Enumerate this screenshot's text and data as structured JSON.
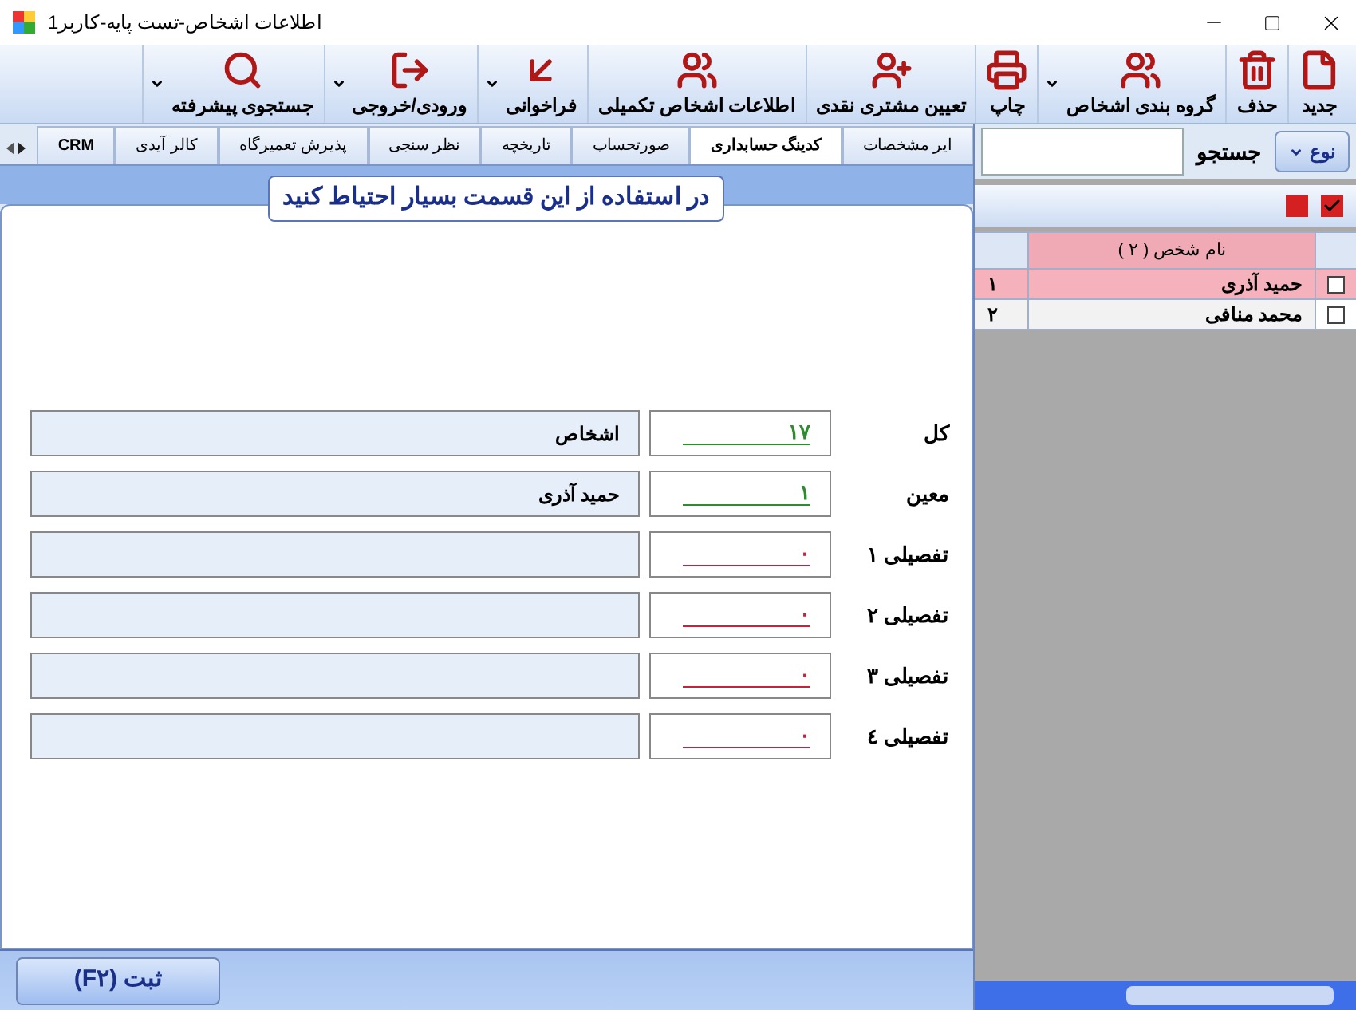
{
  "window": {
    "title": "اطلاعات اشخاص-تست پایه-کاربر1"
  },
  "toolbar": [
    {
      "kind": "new",
      "label": "جدید",
      "dropdown": false
    },
    {
      "kind": "delete",
      "label": "حذف",
      "dropdown": false
    },
    {
      "kind": "group",
      "label": "گروه بندی اشخاص",
      "dropdown": true
    },
    {
      "kind": "print",
      "label": "چاپ",
      "dropdown": false
    },
    {
      "kind": "adduser",
      "label": "تعیین مشتری نقدی",
      "dropdown": false
    },
    {
      "kind": "info",
      "label": "اطلاعات اشخاص تکمیلی",
      "dropdown": false
    },
    {
      "kind": "recall",
      "label": "فراخوانی",
      "dropdown": true
    },
    {
      "kind": "io",
      "label": "ورودی/خروجی",
      "dropdown": true
    },
    {
      "kind": "search",
      "label": "جستجوی پیشرفته",
      "dropdown": true
    }
  ],
  "tabs": [
    {
      "label": "ایر مشخصات",
      "selected": false
    },
    {
      "label": "کدینگ حسابداری",
      "selected": true
    },
    {
      "label": "صورتحساب",
      "selected": false
    },
    {
      "label": "تاریخچه",
      "selected": false
    },
    {
      "label": "نظر سنجی",
      "selected": false
    },
    {
      "label": "پذیرش تعمیرگاه",
      "selected": false
    },
    {
      "label": "کالر آیدی",
      "selected": false
    },
    {
      "label": "CRM",
      "selected": false
    }
  ],
  "warning": "در استفاده از این قسمت بسیار احتیاط کنید",
  "rows": [
    {
      "label": "کل",
      "code": "۱۷",
      "color": "#2e8b2e",
      "name": "اشخاص"
    },
    {
      "label": "معین",
      "code": "۱",
      "color": "#2e8b2e",
      "name": "حمید آذری"
    },
    {
      "label": "تفصیلی ۱",
      "code": "۰",
      "color": "#cc1f3c",
      "name": ""
    },
    {
      "label": "تفصیلی ۲",
      "code": "۰",
      "color": "#cc1f3c",
      "name": ""
    },
    {
      "label": "تفصیلی ۳",
      "code": "۰",
      "color": "#cc1f3c",
      "name": ""
    },
    {
      "label": "تفصیلی ٤",
      "code": "۰",
      "color": "#cc1f3c",
      "name": ""
    }
  ],
  "save_button": "ثبت (F۲)",
  "search": {
    "type_button": "نوع",
    "label": "جستجو"
  },
  "grid": {
    "column": "نام شخص ( ۲ )",
    "rows": [
      {
        "number": "۱",
        "name": "حمید آذری",
        "checked": false,
        "selected": true
      },
      {
        "number": "۲",
        "name": "محمد منافی",
        "checked": false,
        "selected": false
      }
    ]
  }
}
